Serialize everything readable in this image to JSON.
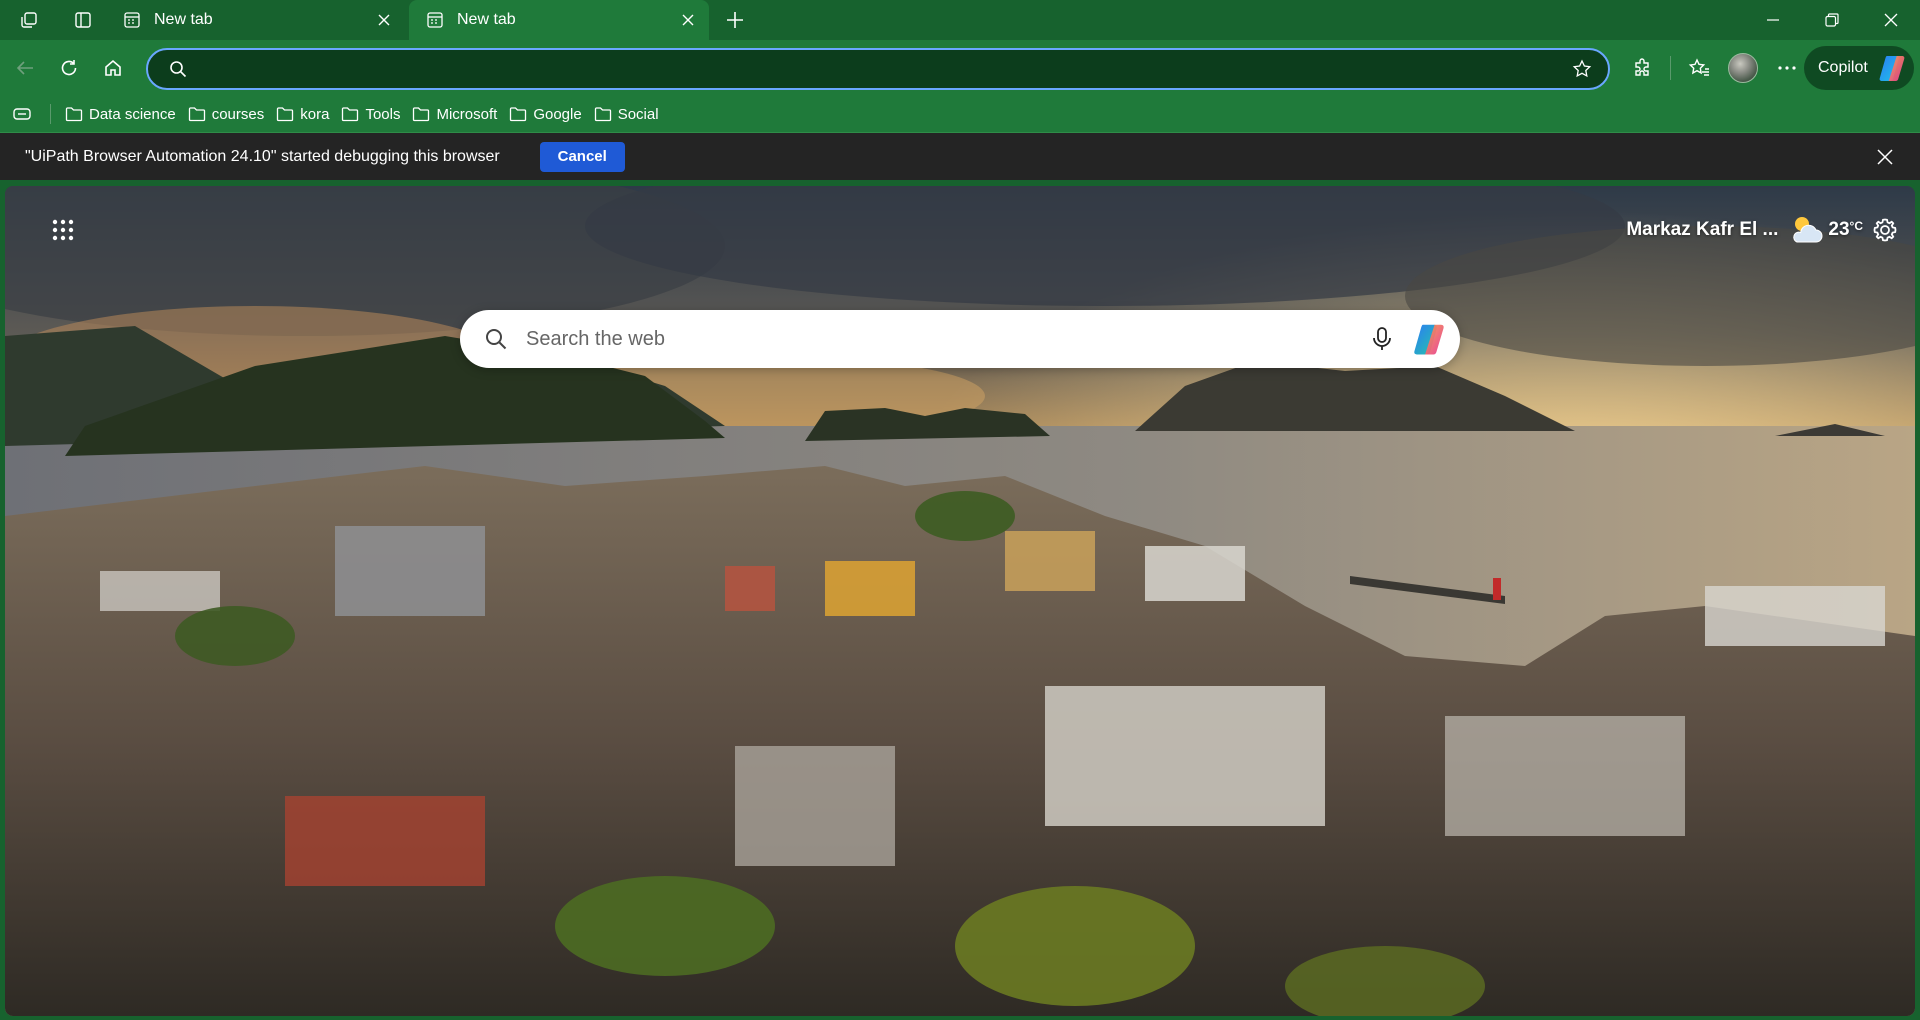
{
  "tabs": [
    {
      "title": "New tab",
      "active": false
    },
    {
      "title": "New tab",
      "active": true
    }
  ],
  "toolbar": {
    "address_value": "",
    "copilot_label": "Copilot"
  },
  "favorites": [
    {
      "label": "Data science",
      "icon": "folder-icon"
    },
    {
      "label": "courses",
      "icon": "folder-icon"
    },
    {
      "label": "kora",
      "icon": "folder-icon"
    },
    {
      "label": "Tools",
      "icon": "folder-icon"
    },
    {
      "label": "Microsoft",
      "icon": "folder-icon"
    },
    {
      "label": "Google",
      "icon": "folder-icon"
    },
    {
      "label": "Social",
      "icon": "folder-icon"
    }
  ],
  "infobar": {
    "message": "\"UiPath Browser Automation 24.10\" started debugging this browser",
    "cancel_label": "Cancel"
  },
  "newtab": {
    "search_placeholder": "Search the web",
    "weather": {
      "location": "Markaz Kafr El ...",
      "temperature": "23",
      "unit": "°C",
      "condition_icon": "partly-cloudy-icon"
    }
  },
  "colors": {
    "frame": "#17622e",
    "toolbar": "#1f7a3a",
    "address_bg": "#0c3d1c",
    "focus_ring": "#6aa7ff",
    "infobar_bg": "#242424",
    "cancel_button": "#1f5ad6"
  }
}
